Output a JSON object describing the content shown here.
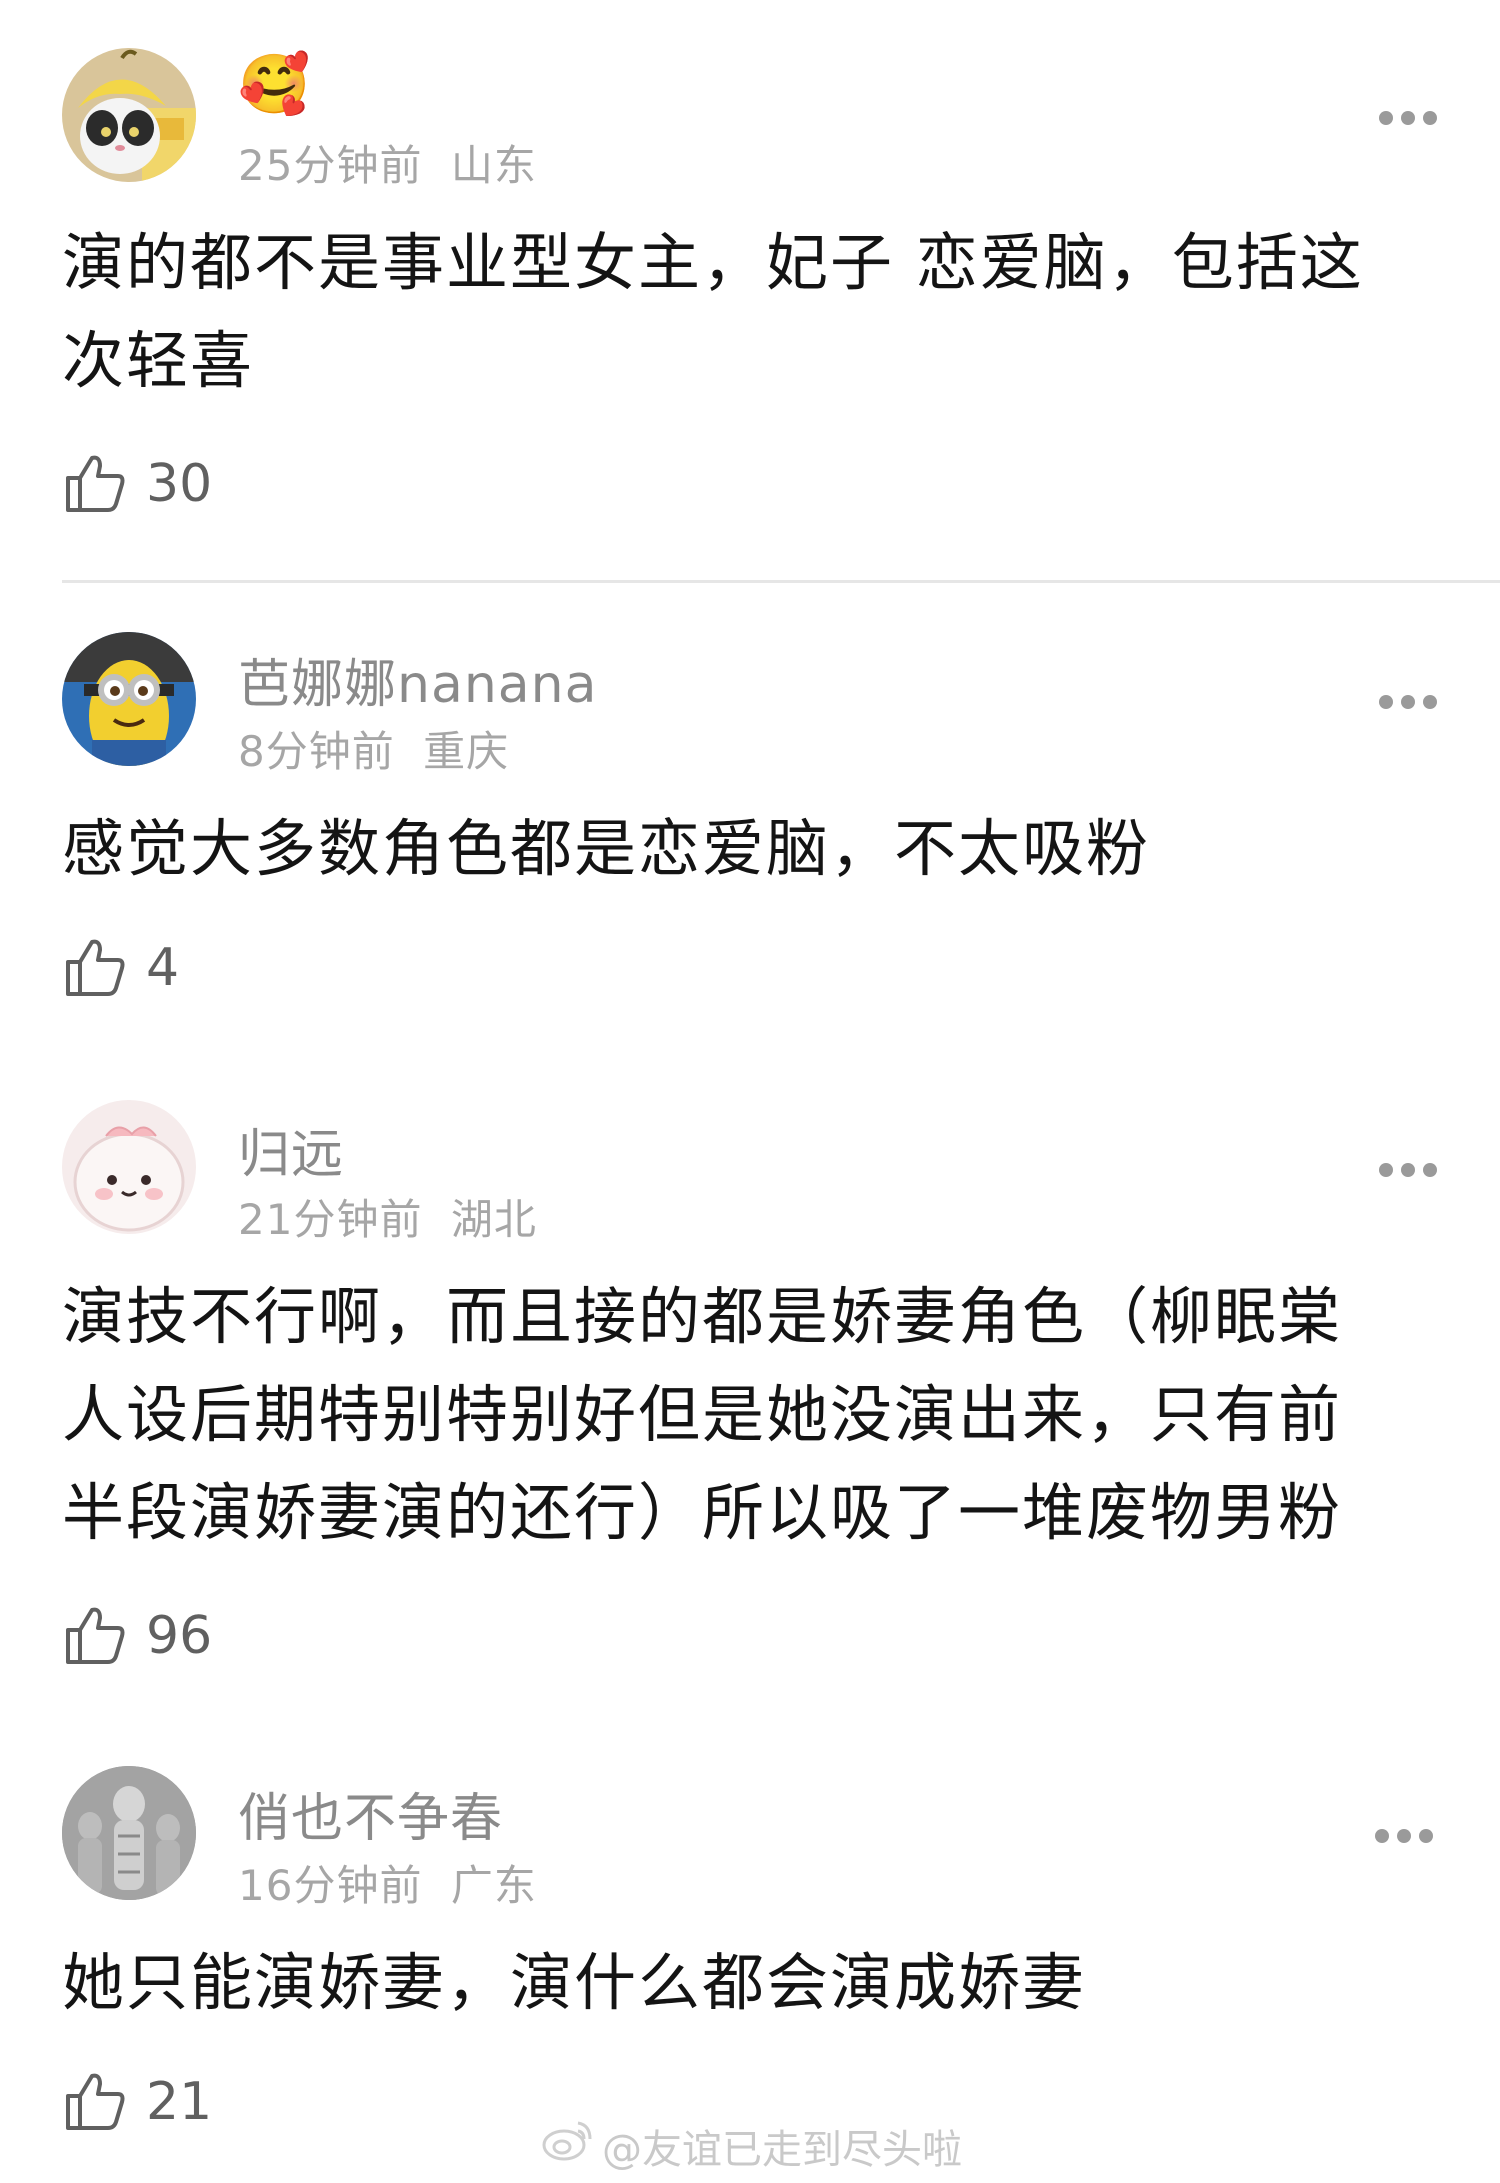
{
  "comments": [
    {
      "username": "🥰",
      "time": "25分钟前",
      "location": "山东",
      "text_lines": [
        "演的都不是事业型女主，妃子 恋爱脑，包括这",
        "次轻喜"
      ],
      "likes": "30",
      "avatar_icon": "cat-with-banana-hat-avatar"
    },
    {
      "username": "芭娜娜nanana",
      "time": "8分钟前",
      "location": "重庆",
      "text_lines": [
        "感觉大多数角色都是恋爱脑，不太吸粉"
      ],
      "likes": "4",
      "avatar_icon": "minion-avatar"
    },
    {
      "username": "归远",
      "time": "21分钟前",
      "location": "湖北",
      "text_lines": [
        "演技不行啊，而且接的都是娇妻角色（柳眠棠",
        "人设后期特别特别好但是她没演出来，只有前",
        "半段演娇妻演的还行）所以吸了一堆废物男粉"
      ],
      "likes": "96",
      "avatar_icon": "pink-cartoon-avatar"
    },
    {
      "username": "俏也不争春",
      "time": "16分钟前",
      "location": "广东",
      "text_lines": [
        "她只能演娇妻，演什么都会演成娇妻"
      ],
      "likes": "21",
      "avatar_icon": "stone-statue-avatar"
    }
  ],
  "watermark": "@友谊已走到尽头啦",
  "colors": {
    "username": "#8a8a8a",
    "meta": "#a6a6a6",
    "body": "#141414",
    "like": "#606060",
    "divider": "#e6e6e6"
  }
}
